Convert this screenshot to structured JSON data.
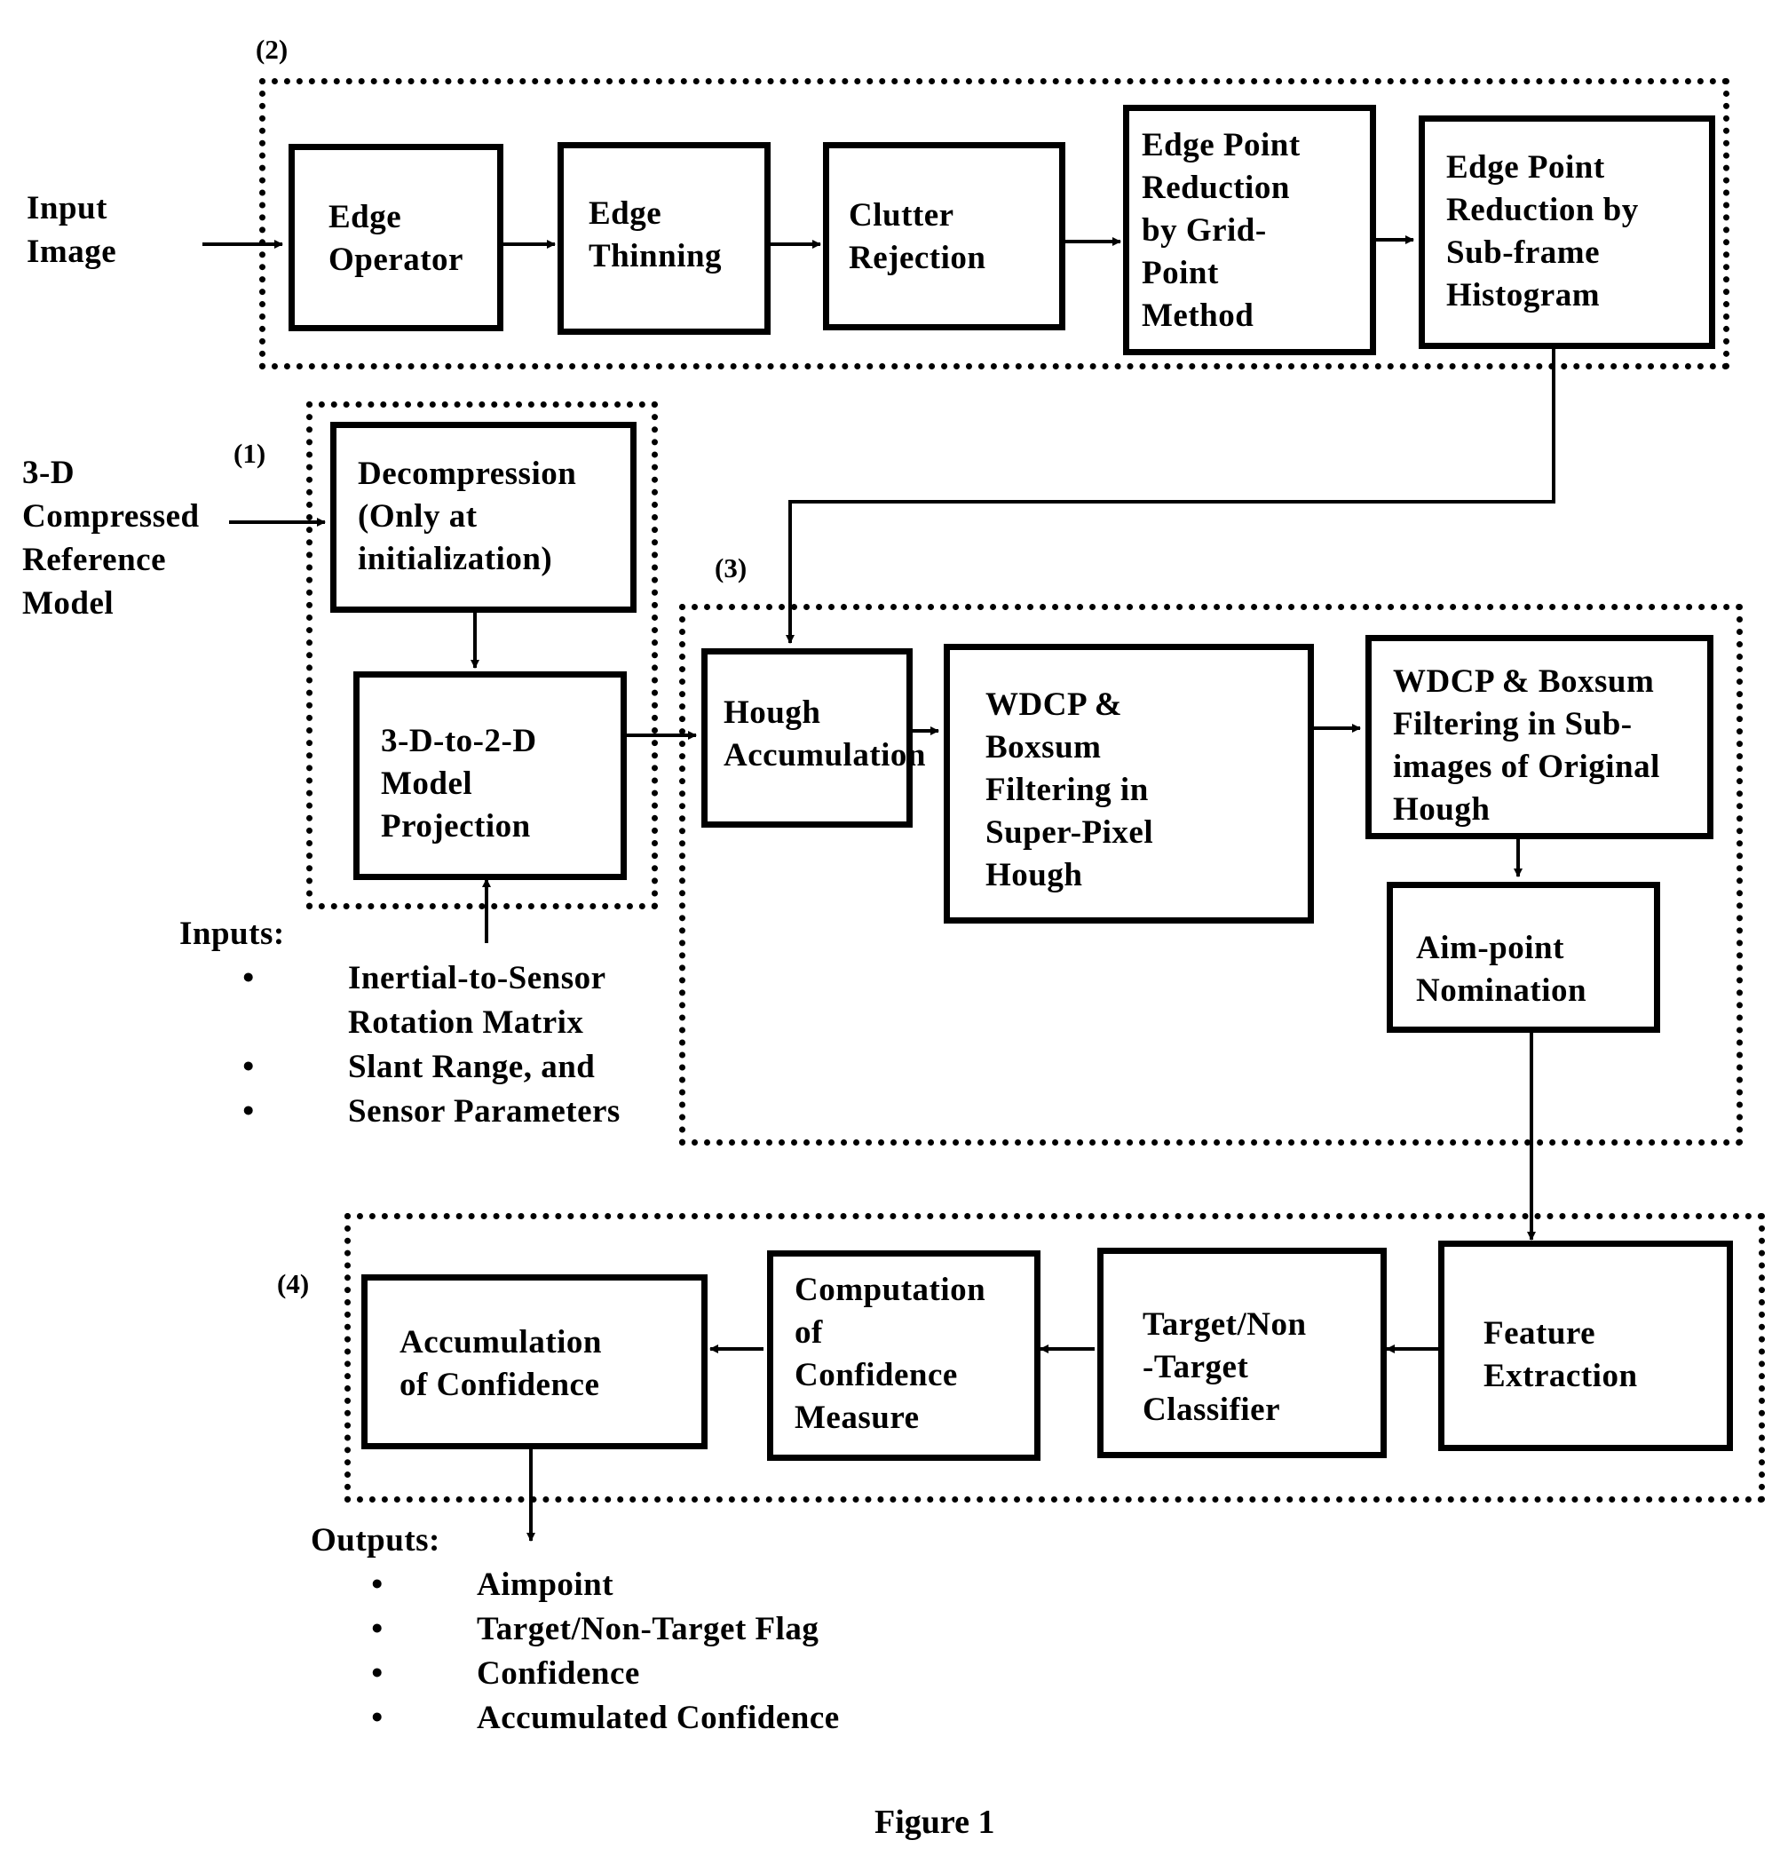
{
  "figure_caption": "Figure 1",
  "groups": {
    "g1": {
      "label": "(1)"
    },
    "g2": {
      "label": "(2)"
    },
    "g3": {
      "label": "(3)"
    },
    "g4": {
      "label": "(4)"
    }
  },
  "external_inputs": {
    "input_image": [
      "Input",
      "Image"
    ],
    "reference_model": [
      "3-D",
      "Compressed",
      "Reference",
      "Model"
    ]
  },
  "blocks": {
    "edge_operator": [
      "Edge",
      "Operator"
    ],
    "edge_thinning": [
      "Edge",
      "Thinning"
    ],
    "clutter_rejection": [
      "Clutter",
      "Rejection"
    ],
    "grid_point": [
      "Edge Point",
      "Reduction",
      "by Grid-",
      "Point",
      "Method"
    ],
    "subframe_histogram": [
      "Edge Point",
      "Reduction by",
      "Sub-frame",
      "Histogram"
    ],
    "decompression": [
      "Decompression",
      "(Only at",
      "initialization)"
    ],
    "projection": [
      "3-D-to-2-D",
      "Model",
      "Projection"
    ],
    "hough_accumulation": [
      "Hough",
      "Accumulation"
    ],
    "wdcp_superpixel": [
      "WDCP &",
      "Boxsum",
      "Filtering in",
      "Super-Pixel",
      "Hough"
    ],
    "wdcp_subimages": [
      "WDCP & Boxsum",
      "Filtering in Sub-",
      "images of Original",
      "Hough"
    ],
    "aimpoint_nomination": [
      "Aim-point",
      "Nomination"
    ],
    "feature_extraction": [
      "Feature",
      "Extraction"
    ],
    "classifier": [
      "Target/Non",
      "-Target",
      "Classifier"
    ],
    "confidence_measure": [
      "Computation",
      "of",
      "Confidence",
      "Measure"
    ],
    "confidence_accumulation": [
      "Accumulation",
      "of Confidence"
    ]
  },
  "inputs_list": {
    "heading": "Inputs:",
    "bullet": "•",
    "items": [
      [
        "Inertial-to-Sensor",
        "Rotation Matrix"
      ],
      [
        "Slant Range, and"
      ],
      [
        "Sensor Parameters"
      ]
    ]
  },
  "outputs_list": {
    "heading": "Outputs:",
    "bullet": "•",
    "items": [
      "Aimpoint",
      "Target/Non-Target Flag",
      "Confidence",
      "Accumulated Confidence"
    ]
  }
}
